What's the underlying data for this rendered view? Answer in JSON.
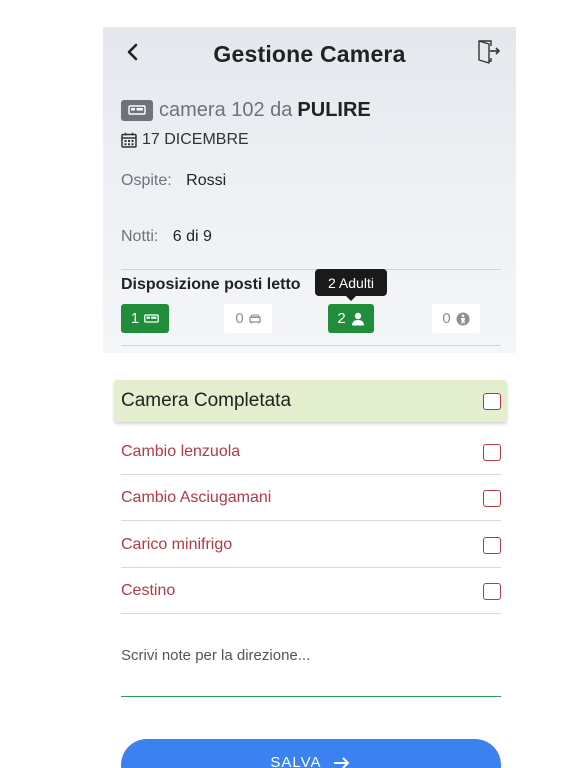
{
  "header": {
    "title": "Gestione Camera",
    "back_icon": "chevron-left-icon",
    "exit_icon": "exit-door-icon"
  },
  "room": {
    "badge_icon": "bed-icon",
    "text": "camera 102 da",
    "status": "PULIRE",
    "date": "17 DICEMBRE"
  },
  "guest": {
    "label": "Ospite:",
    "value": "Rossi"
  },
  "nights": {
    "label": "Notti:",
    "value": "6 di 9"
  },
  "beds": {
    "title": "Disposizione posti letto",
    "tooltip": "2 Adulti",
    "items": [
      {
        "count": "1",
        "icon": "double-bed-icon",
        "active": true
      },
      {
        "count": "0",
        "icon": "single-bed-icon",
        "active": false
      },
      {
        "count": "2",
        "icon": "adult-person-icon",
        "active": true
      },
      {
        "count": "0",
        "icon": "child-icon",
        "active": false
      }
    ]
  },
  "tasks": {
    "complete_label": "Camera Completata",
    "items": [
      {
        "label": "Cambio lenzuola",
        "checked": false
      },
      {
        "label": "Cambio Asciugamani",
        "checked": false
      },
      {
        "label": "Carico minifrigo",
        "checked": false
      },
      {
        "label": "Cestino",
        "checked": false
      }
    ]
  },
  "notes": {
    "placeholder": "Scrivi note per la direzione...",
    "value": ""
  },
  "save": {
    "label": "SALVA"
  },
  "colors": {
    "accent_green": "#1f8d3a",
    "task_red": "#b03a48",
    "complete_bg": "#e4efcf",
    "save_blue": "#3b82f0"
  }
}
